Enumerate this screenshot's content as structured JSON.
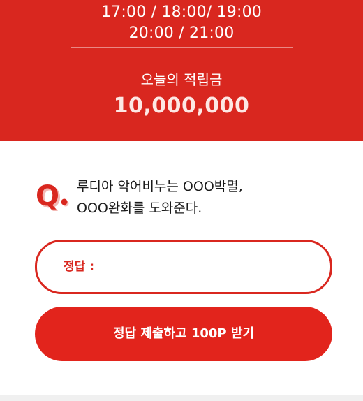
{
  "banner": {
    "times_line1": "17:00 / 18:00/ 19:00",
    "times_line2": "20:00 / 21:00",
    "reward_label": "오늘의 적립금",
    "reward_amount": "10,000,000",
    "background_color": "#d9271f"
  },
  "quiz": {
    "icon": "q-icon",
    "question_line1": "루디아 악어비누는 OOO박멸,",
    "question_line2": "OOO완화를 도와준다."
  },
  "answer": {
    "label": "정답 :",
    "value": "",
    "placeholder": ""
  },
  "submit": {
    "label": "정답 제출하고 100P 받기",
    "color": "#e2241c"
  }
}
